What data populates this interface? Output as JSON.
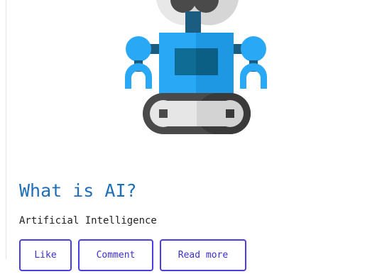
{
  "article": {
    "image_icon": "robot-icon",
    "title": "What is AI?",
    "subtitle": "Artificial Intelligence",
    "actions": {
      "like_label": "Like",
      "comment_label": "Comment",
      "read_more_label": "Read more"
    }
  },
  "colors": {
    "title": "#1f6fb8",
    "button_border": "#4b3de0",
    "button_text": "#3b2fd1",
    "robot_body": "#29a9f5",
    "robot_dark": "#0f6d95"
  }
}
